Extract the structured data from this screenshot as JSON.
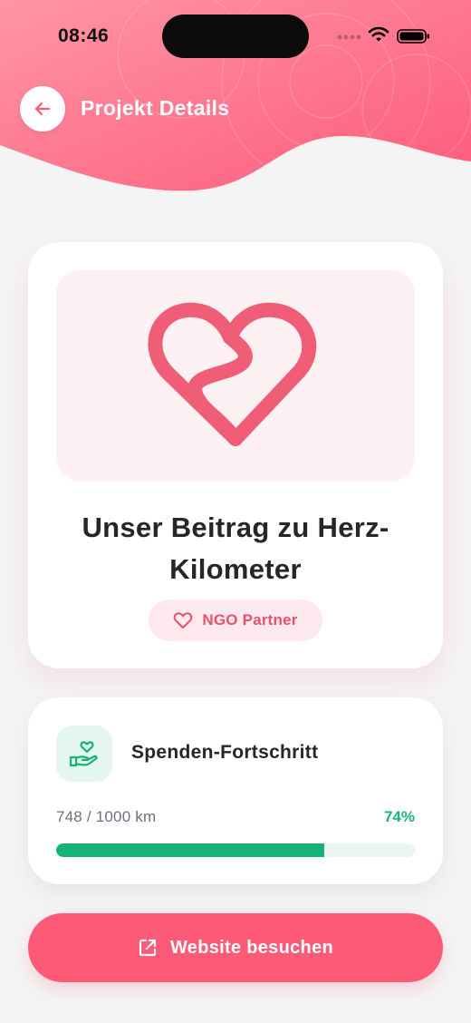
{
  "status_bar": {
    "time": "08:46"
  },
  "header": {
    "title": "Projekt Details",
    "back_icon": "arrow-left-icon",
    "gradient_start": "#ff8a9c",
    "gradient_end": "#fd5b79"
  },
  "project": {
    "image_icon": "heart-road-icon",
    "title": "Unser Beitrag zu Herz-Kilometer",
    "badge": {
      "icon": "heart-outline-icon",
      "label": "NGO Partner"
    }
  },
  "progress": {
    "icon": "hand-heart-icon",
    "heading": "Spenden-Fortschritt",
    "amount_text": "748 / 1000 km",
    "percent_text": "74%",
    "fraction": 0.748
  },
  "website_button": {
    "icon": "external-link-icon",
    "label": "Website besuchen"
  },
  "colors": {
    "accent": "#fd5a78",
    "success": "#17b27a",
    "background": "#f4f4f5"
  }
}
